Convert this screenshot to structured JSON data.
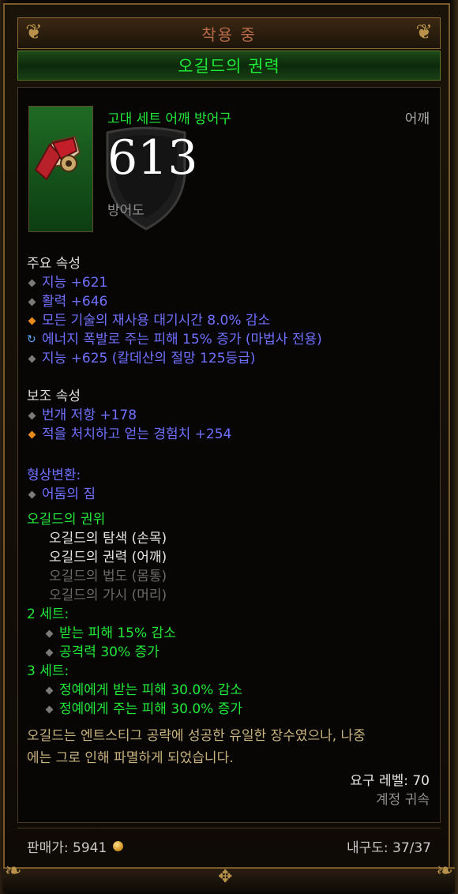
{
  "header": {
    "title": "착용 중"
  },
  "item": {
    "name": "오길드의 권력",
    "type_line": "고대 세트 어깨 방어구",
    "slot": "어깨",
    "armor_value": "613",
    "armor_label": "방어도"
  },
  "primary": {
    "heading": "주요 속성",
    "attrs": [
      {
        "text": "지능 +621",
        "bullet": "grey-diamond"
      },
      {
        "text": "활력 +646",
        "bullet": "grey-diamond"
      },
      {
        "text": "모든 기술의 재사용 대기시간 8.0% 감소",
        "bullet": "orange-diamond"
      },
      {
        "text": "에너지 폭발로 주는 피해 15% 증가 (마법사 전용)",
        "bullet": "blue-swirl"
      },
      {
        "text": "지능 +625 (칼데산의 절망 125등급)",
        "bullet": "grey-diamond"
      }
    ]
  },
  "secondary": {
    "heading": "보조 속성",
    "attrs": [
      {
        "text": "번개 저항 +178",
        "bullet": "grey-diamond"
      },
      {
        "text": "적을 처치하고 얻는 경험치 +254",
        "bullet": "orange-diamond"
      }
    ]
  },
  "transmog": {
    "heading": "형상변환:",
    "value": "어둠의 짐"
  },
  "set": {
    "name": "오길드의 권위",
    "pieces": [
      {
        "name": "오길드의 탐색 (손목)",
        "owned": true
      },
      {
        "name": "오길드의 권력 (어깨)",
        "owned": true
      },
      {
        "name": "오길드의 법도 (몸통)",
        "owned": false
      },
      {
        "name": "오길드의 가시 (머리)",
        "owned": false
      }
    ],
    "bonuses": [
      {
        "label": "2 세트:",
        "effects": [
          "받는 피해 15% 감소",
          "공격력 30% 증가"
        ]
      },
      {
        "label": "3 세트:",
        "effects": [
          "정예에게 받는 피해 30.0% 감소",
          "정예에게 주는 피해 30.0% 증가"
        ]
      }
    ]
  },
  "flavor": {
    "line1": "오길드는 엔트스티그 공략에 성공한 유일한 장수였으나, 나중",
    "line2": "에는 그로 인해 파멸하게 되었습니다."
  },
  "requirement": {
    "level": "요구 레벨: 70",
    "bound": "계정 귀속"
  },
  "footer": {
    "sell_price": "판매가: 5941",
    "durability": "내구도: 37/37"
  },
  "colors": {
    "set_green": "#22e83a",
    "magic_blue": "#7070ff",
    "legendary_orange": "#e88a1e",
    "header_text": "#b96a48",
    "flavor": "#c9b37e"
  }
}
